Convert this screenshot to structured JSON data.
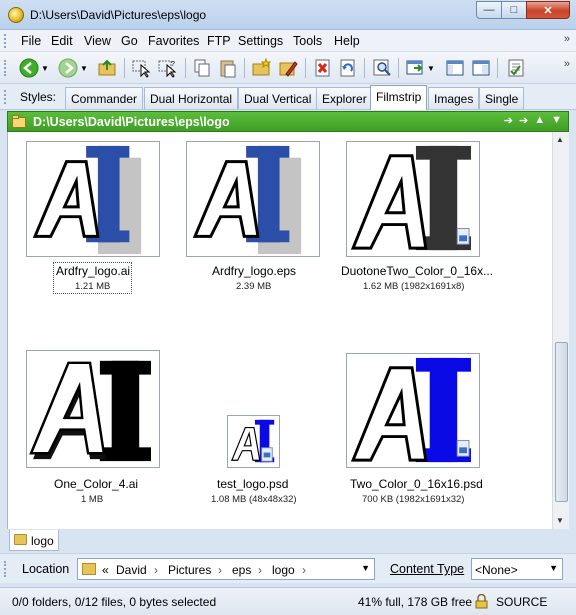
{
  "window": {
    "title": "D:\\Users\\David\\Pictures\\eps\\logo"
  },
  "menu": [
    "File",
    "Edit",
    "View",
    "Go",
    "Favorites",
    "FTP",
    "Settings",
    "Tools",
    "Help"
  ],
  "styles": {
    "label": "Styles:",
    "tabs": [
      "Commander",
      "Dual Horizontal",
      "Dual Vertical",
      "Explorer",
      "Filmstrip",
      "Images",
      "Single"
    ],
    "active": "Filmstrip"
  },
  "path": "D:\\Users\\David\\Pictures\\eps\\logo",
  "files": [
    {
      "name": "Ardfry_logo.ai",
      "meta": "1.21 MB"
    },
    {
      "name": "Ardfry_logo.eps",
      "meta": "2.39 MB"
    },
    {
      "name": "DuotoneTwo_Color_0_16x...",
      "meta": "1.62 MB (1982x1691x8)"
    },
    {
      "name": "One_Color_4.ai",
      "meta": "1 MB"
    },
    {
      "name": "test_logo.psd",
      "meta": "1.08 MB (48x48x32)"
    },
    {
      "name": "Two_Color_0_16x16.psd",
      "meta": "700 KB (1982x1691x32)"
    }
  ],
  "bottom_tab": "logo",
  "location": {
    "label": "Location",
    "crumbs": [
      "«",
      "David",
      "Pictures",
      "eps",
      "logo"
    ]
  },
  "content_type": {
    "label": "Content Type",
    "value": "<None>"
  },
  "status": {
    "left": "0/0 folders, 0/12 files, 0 bytes selected",
    "disk": "41% full, 178 GB free",
    "source": "SOURCE"
  },
  "colors": {
    "path_bar": "#4caf30",
    "logo_blue": "#2b4fa8",
    "logo_bright_blue": "#0a0ae6"
  }
}
